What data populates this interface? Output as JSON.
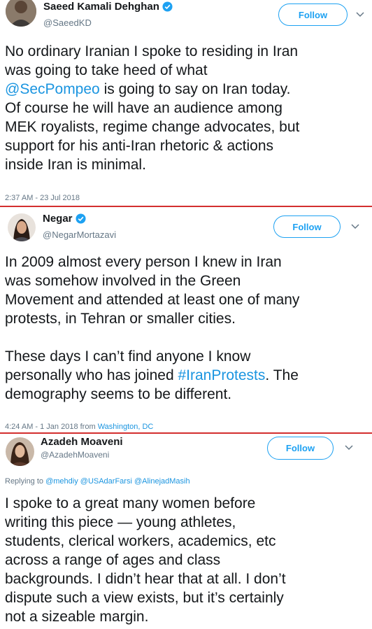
{
  "tweets": [
    {
      "name": "Saeed Kamali Dehghan",
      "handle": "@SaeedKD",
      "follow_label": "Follow",
      "text_lines": [
        "No ordinary Iranian I spoke to residing in Iran",
        "was going to take heed of what"
      ],
      "mention": "@SecPompeo",
      "text_after_mention": " is going to say on Iran today.",
      "text_rest": [
        "Of course he will have an audience among",
        "MEK royalists, regime change advocates, but",
        "support for his anti-Iran rhetoric & actions",
        "inside Iran is minimal."
      ],
      "timestamp": "2:37 AM - 23 Jul 2018"
    },
    {
      "name": "Negar",
      "handle": "@NegarMortazavi",
      "follow_label": "Follow",
      "para1": [
        "In 2009 almost every person I knew in Iran",
        "was somehow involved in the Green",
        "Movement and attended at least one of many",
        "protests, in Tehran or smaller cities."
      ],
      "para2_line1": "These days I can’t find anyone I know",
      "para2_line2_before": "personally who has joined ",
      "hashtag": "#IranProtests",
      "para2_line2_after": ". The",
      "para2_line3": "demography seems to be different.",
      "timestamp": "4:24 AM - 1 Jan 2018 from ",
      "location": "Washington, DC"
    },
    {
      "name": "Azadeh Moaveni",
      "handle": "@AzadehMoaveni",
      "follow_label": "Follow",
      "replying_prefix": "Replying to ",
      "replying_to": "@mehdiy @USAdarFarsi @AlinejadMasih",
      "text_lines": [
        "I spoke to a great many women before",
        "writing this piece — young athletes,",
        "students, clerical workers, academics, etc",
        "across a range of ages and class",
        "backgrounds. I didn’t hear that at all. I don’t",
        "dispute such a view exists, but it’s certainly",
        "not a sizeable margin."
      ]
    }
  ],
  "colors": {
    "accent": "#1da1f2",
    "divider": "#d32f2f",
    "text": "#14171a",
    "muted": "#657786"
  }
}
